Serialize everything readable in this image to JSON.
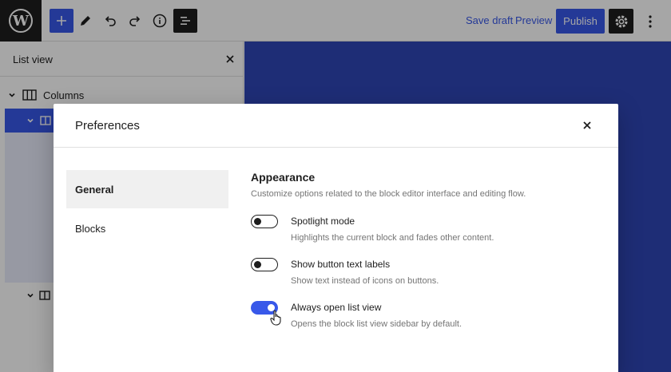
{
  "toolbar": {
    "save_draft": "Save draft",
    "preview": "Preview",
    "publish": "Publish"
  },
  "list_view": {
    "title": "List view",
    "items": [
      {
        "label": "Columns"
      }
    ]
  },
  "modal": {
    "title": "Preferences",
    "tabs": [
      {
        "label": "General",
        "active": true
      },
      {
        "label": "Blocks",
        "active": false
      }
    ],
    "section": {
      "title": "Appearance",
      "description": "Customize options related to the block editor interface and editing flow."
    },
    "options": [
      {
        "label": "Spotlight mode",
        "help": "Highlights the current block and fades other content.",
        "enabled": false
      },
      {
        "label": "Show button text labels",
        "help": "Show text instead of icons on buttons.",
        "enabled": false
      },
      {
        "label": "Always open list view",
        "help": "Opens the block list view sidebar by default.",
        "enabled": true
      }
    ]
  },
  "colors": {
    "accent": "#3858e9",
    "canvas": "#2f46b5",
    "dark": "#1e1e1e"
  },
  "icons": [
    "wordpress-logo-icon",
    "plus-icon",
    "pencil-icon",
    "undo-icon",
    "redo-icon",
    "info-icon",
    "outline-icon",
    "gear-icon",
    "more-vertical-icon",
    "close-icon",
    "chevron-down-icon",
    "columns-icon",
    "column-icon",
    "pointer-hand-icon"
  ]
}
